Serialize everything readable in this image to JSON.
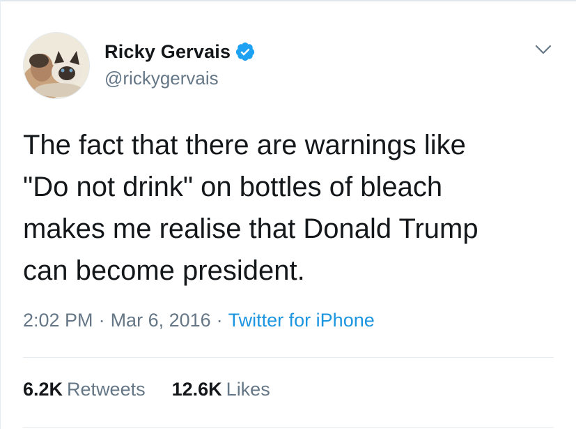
{
  "tweet": {
    "author": {
      "display_name": "Ricky Gervais",
      "handle": "@rickygervais",
      "verified_icon": "verified-badge-icon",
      "avatar_icon": "profile-avatar"
    },
    "menu_icon": "chevron-down-icon",
    "text": "The fact that there are warnings like\n\"Do not drink\" on bottles of bleach\nmakes me realise that Donald Trump\ncan become president.",
    "time": "2:02 PM",
    "date": "Mar 6, 2016",
    "separator": "·",
    "source": "Twitter for iPhone",
    "stats": {
      "retweets_count": "6.2K",
      "retweets_label": "Retweets",
      "likes_count": "12.6K",
      "likes_label": "Likes"
    }
  },
  "colors": {
    "text_primary": "#14171a",
    "text_secondary": "#657786",
    "link": "#1b95e0",
    "verified": "#1da1f2",
    "divider": "#e6ecf0"
  }
}
